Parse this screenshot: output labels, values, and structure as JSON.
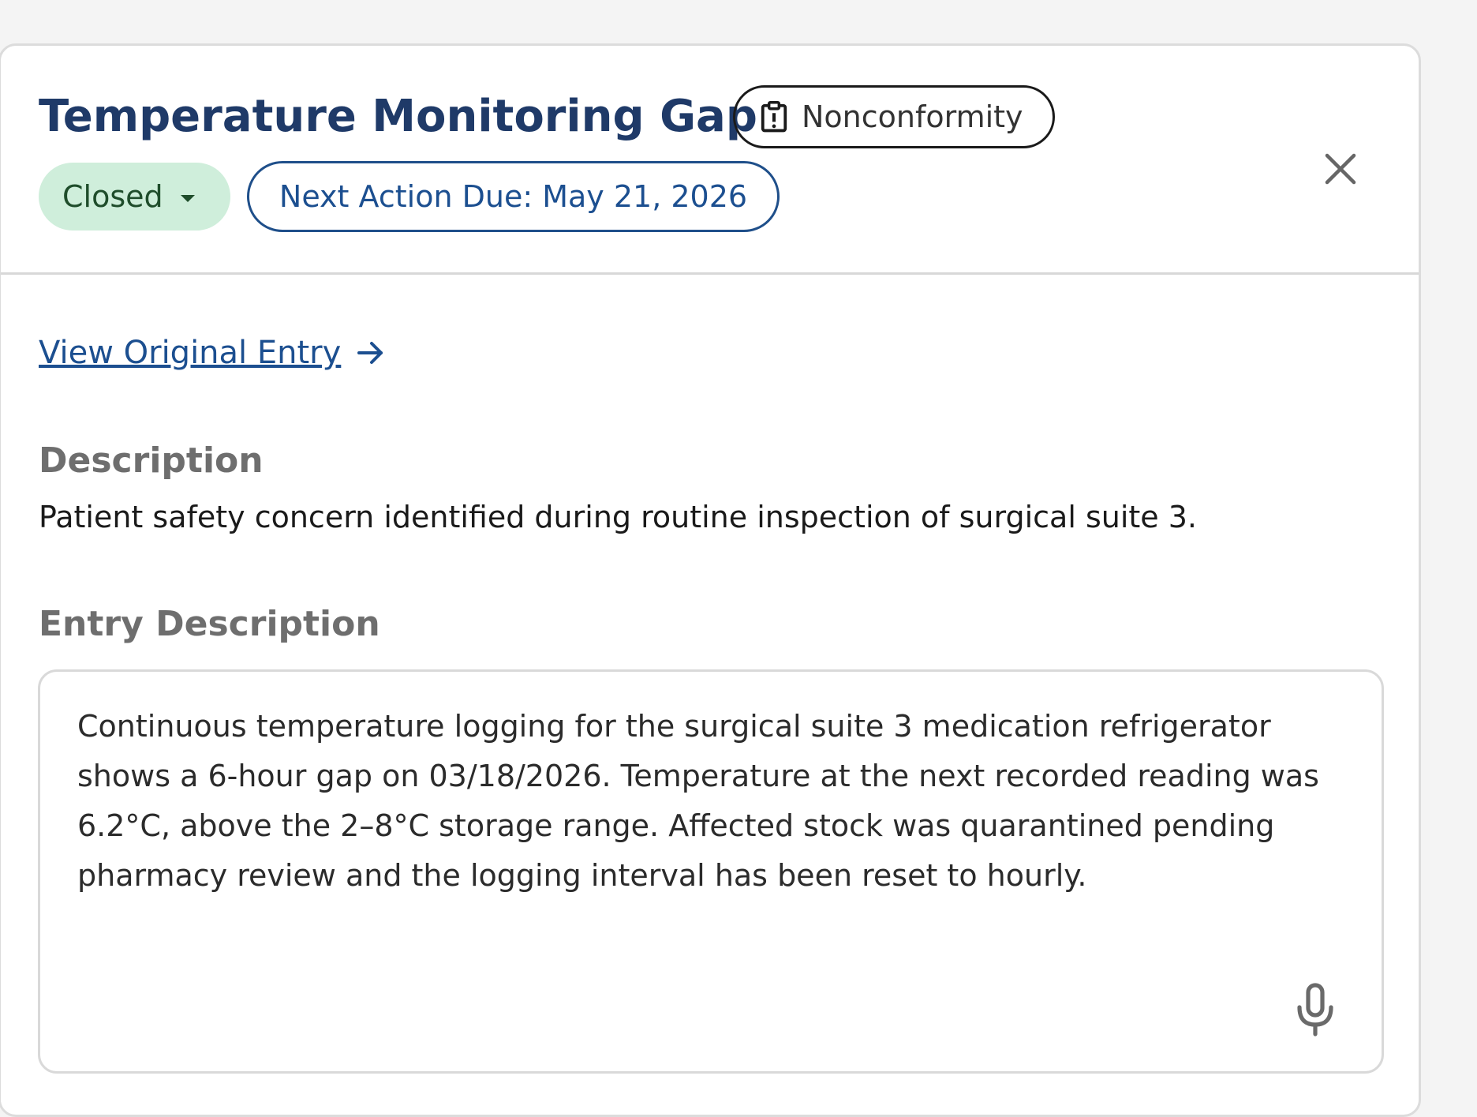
{
  "header": {
    "title": "Temperature Monitoring Gap",
    "type_badge": {
      "label": "Nonconformity",
      "icon": "clipboard-alert-icon"
    },
    "close_icon": "close-icon",
    "status": {
      "label": "Closed",
      "color": "#cfeedb"
    },
    "next_action": {
      "label": "Next Action Due: May 21, 2026"
    }
  },
  "links": {
    "view_original": "View Original Entry"
  },
  "description": {
    "label": "Description",
    "text": "Patient safety concern identified during routine inspection of surgical suite 3."
  },
  "entry_description": {
    "label": "Entry Description",
    "value": "Continuous temperature logging for the surgical suite 3 medication refrigerator shows a 6-hour gap on 03/18/2026. Temperature at the next recorded reading was 6.2°C, above the 2–8°C storage range. Affected stock was quarantined pending pharmacy review and the logging interval has been reset to hourly.",
    "mic_icon": "microphone-icon"
  },
  "colors": {
    "title": "#1f3a68",
    "accent_blue": "#1c4f90",
    "status_green_bg": "#cfeedb",
    "status_green_text": "#1f4d2b"
  }
}
